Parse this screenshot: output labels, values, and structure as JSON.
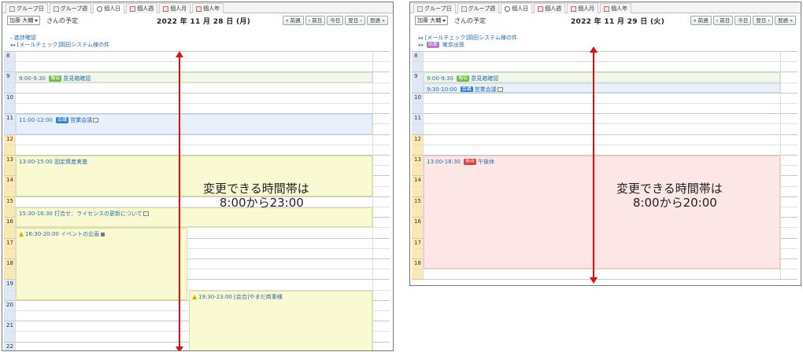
{
  "tabs": [
    {
      "label": "グループ日",
      "icon": "group-day-icon"
    },
    {
      "label": "グループ週",
      "icon": "group-week-icon"
    },
    {
      "label": "個人日",
      "icon": "clock-icon"
    },
    {
      "label": "個人週",
      "icon": "calendar-icon"
    },
    {
      "label": "個人月",
      "icon": "calendar-icon"
    },
    {
      "label": "個人年",
      "icon": "calendar-icon"
    }
  ],
  "user": {
    "selected": "加藤 大輔",
    "suffix": "さんの予定"
  },
  "nav": {
    "prev_week": "« 前週",
    "prev_day": "‹ 前日",
    "today": "今日",
    "next_day": "翌日 ›",
    "next_week": "翌週 »"
  },
  "left": {
    "date": "2022 年 11 月 28 日 (月)",
    "allday": [
      {
        "arrow": "-",
        "text": "進捗確認"
      },
      {
        "arrow": "↔",
        "text": "[メールチェック]岡田システム様の件"
      }
    ],
    "hours": [
      "8",
      "9",
      "10",
      "11",
      "12",
      "13",
      "14",
      "15",
      "16",
      "17",
      "18",
      "19",
      "20",
      "21",
      "22"
    ],
    "events": [
      {
        "time": "9:00-9:30",
        "badge": "報告",
        "badge_color": "#6cc04a",
        "title": "意見箱確認",
        "color": "green"
      },
      {
        "time": "11:00-12:00",
        "badge": "会議",
        "badge_color": "#2f7fd0",
        "title": "営業会議",
        "color": "blue",
        "icon": true
      },
      {
        "time": "13:00-15:00",
        "badge": "",
        "title": "固定資産実査",
        "color": "yellow"
      },
      {
        "time": "15:30-16:30",
        "badge": "",
        "title": "打合せ：ライセンスの更新について",
        "color": "yellow",
        "icon": true
      },
      {
        "time": "16:30-20:00",
        "badge": "",
        "title": "イベントの企画",
        "color": "yellow",
        "warn": true,
        "lock": true
      },
      {
        "time": "19:30-23:00",
        "badge": "",
        "title": "[会合]やまだ商事様",
        "color": "yellow",
        "warn": true
      }
    ],
    "note_line1": "変更できる時間帯は",
    "note_line2": "8:00から23:00"
  },
  "right": {
    "date": "2022 年 11 月 29 日 (火)",
    "allday": [
      {
        "arrow": "↔",
        "text": "[メールチェック]岡田システム様の件"
      },
      {
        "arrow": "↔",
        "badge": "出張",
        "badge_color": "#b675d6",
        "text": "東京出張"
      }
    ],
    "hours": [
      "8",
      "9",
      "10",
      "11",
      "12",
      "13",
      "14",
      "15",
      "16",
      "17",
      "18"
    ],
    "events": [
      {
        "time": "9:00-9:30",
        "badge": "報告",
        "badge_color": "#6cc04a",
        "title": "意見箱確認",
        "color": "green"
      },
      {
        "time": "9:30-10:00",
        "badge": "会議",
        "badge_color": "#2f7fd0",
        "title": "営業会議",
        "color": "blue",
        "icon": true
      },
      {
        "time": "13:00-18:30",
        "badge": "休み",
        "badge_color": "#e0413a",
        "title": "午後休",
        "color": "pink"
      }
    ],
    "note_line1": "変更できる時間帯は",
    "note_line2": "8:00から20:00"
  },
  "colors": {
    "arrow": "#e01010",
    "hour_weekend": "#fde8b0",
    "hour_normal": "#dfe8f6"
  }
}
